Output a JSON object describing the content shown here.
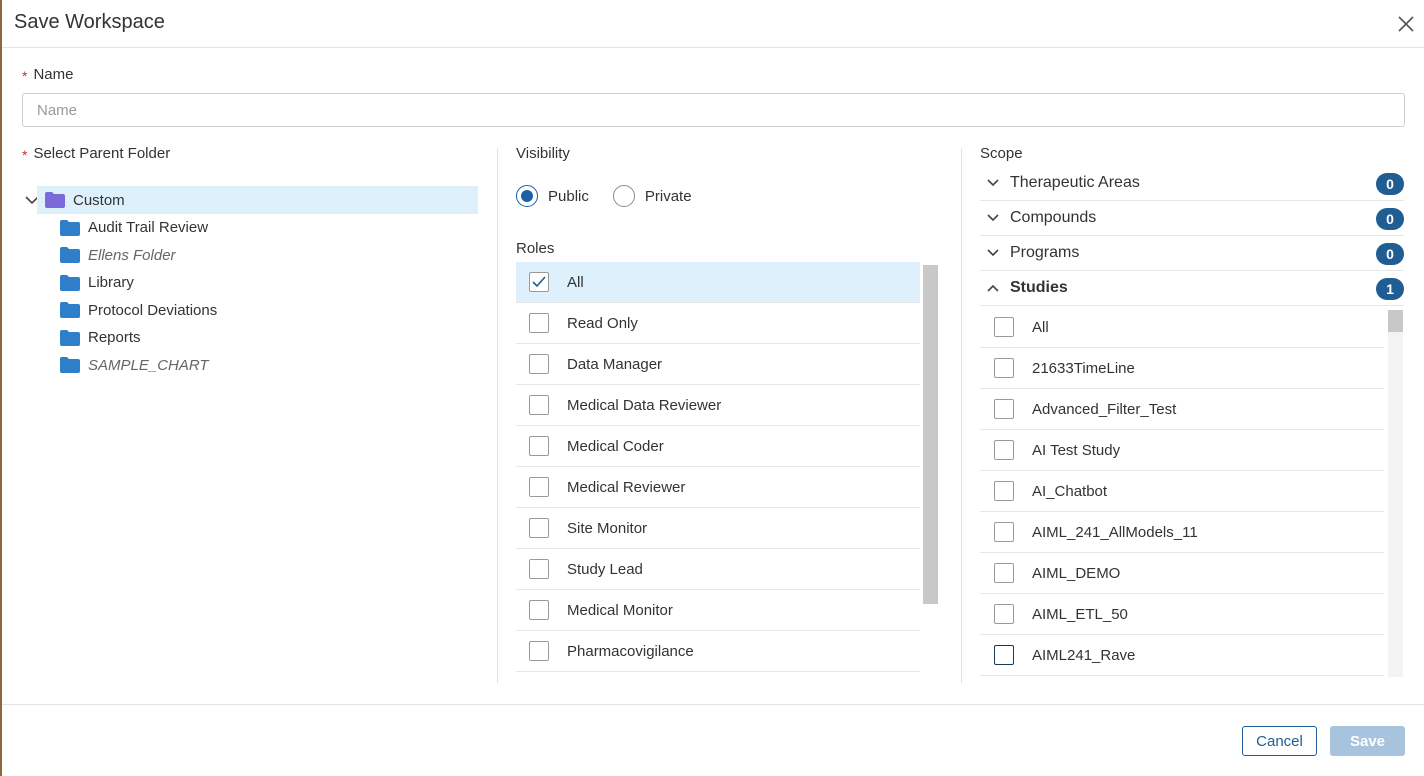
{
  "dialog": {
    "title": "Save Workspace"
  },
  "name_field": {
    "label": "Name",
    "required_mark": "*",
    "placeholder": "Name",
    "value": ""
  },
  "parent_folder": {
    "label": "Select Parent Folder",
    "required_mark": "*",
    "root": "Custom",
    "children": [
      {
        "name": "Audit Trail Review",
        "italic": false
      },
      {
        "name": "Ellens Folder",
        "italic": true
      },
      {
        "name": "Library",
        "italic": false
      },
      {
        "name": "Protocol Deviations",
        "italic": false
      },
      {
        "name": "Reports",
        "italic": false
      },
      {
        "name": "SAMPLE_CHART",
        "italic": true
      }
    ]
  },
  "visibility": {
    "label": "Visibility",
    "options": [
      "Public",
      "Private"
    ],
    "selected": "Public"
  },
  "roles": {
    "label": "Roles",
    "items": [
      {
        "name": "All",
        "checked": true
      },
      {
        "name": "Read Only",
        "checked": false
      },
      {
        "name": "Data Manager",
        "checked": false
      },
      {
        "name": "Medical Data Reviewer",
        "checked": false
      },
      {
        "name": "Medical Coder",
        "checked": false
      },
      {
        "name": "Medical Reviewer",
        "checked": false
      },
      {
        "name": "Site Monitor",
        "checked": false
      },
      {
        "name": "Study Lead",
        "checked": false
      },
      {
        "name": "Medical Monitor",
        "checked": false
      },
      {
        "name": "Pharmacovigilance",
        "checked": false
      }
    ]
  },
  "scope": {
    "label": "Scope",
    "sections": [
      {
        "title": "Therapeutic Areas",
        "count": "0",
        "expanded": false
      },
      {
        "title": "Compounds",
        "count": "0",
        "expanded": false
      },
      {
        "title": "Programs",
        "count": "0",
        "expanded": false
      },
      {
        "title": "Studies",
        "count": "1",
        "expanded": true
      }
    ],
    "studies": [
      "All",
      "21633TimeLine",
      "Advanced_Filter_Test",
      "AI Test Study",
      "AI_Chatbot",
      "AIML_241_AllModels_11",
      "AIML_DEMO",
      "AIML_ETL_50",
      "AIML241_Rave"
    ]
  },
  "footer": {
    "cancel_label": "Cancel",
    "save_label": "Save"
  },
  "colors": {
    "accent": "#1f5d93",
    "selected_bg": "#ddf0fb",
    "root_folder": "#7b68d9",
    "folder": "#2e7ec9",
    "required": "#c0392b"
  }
}
